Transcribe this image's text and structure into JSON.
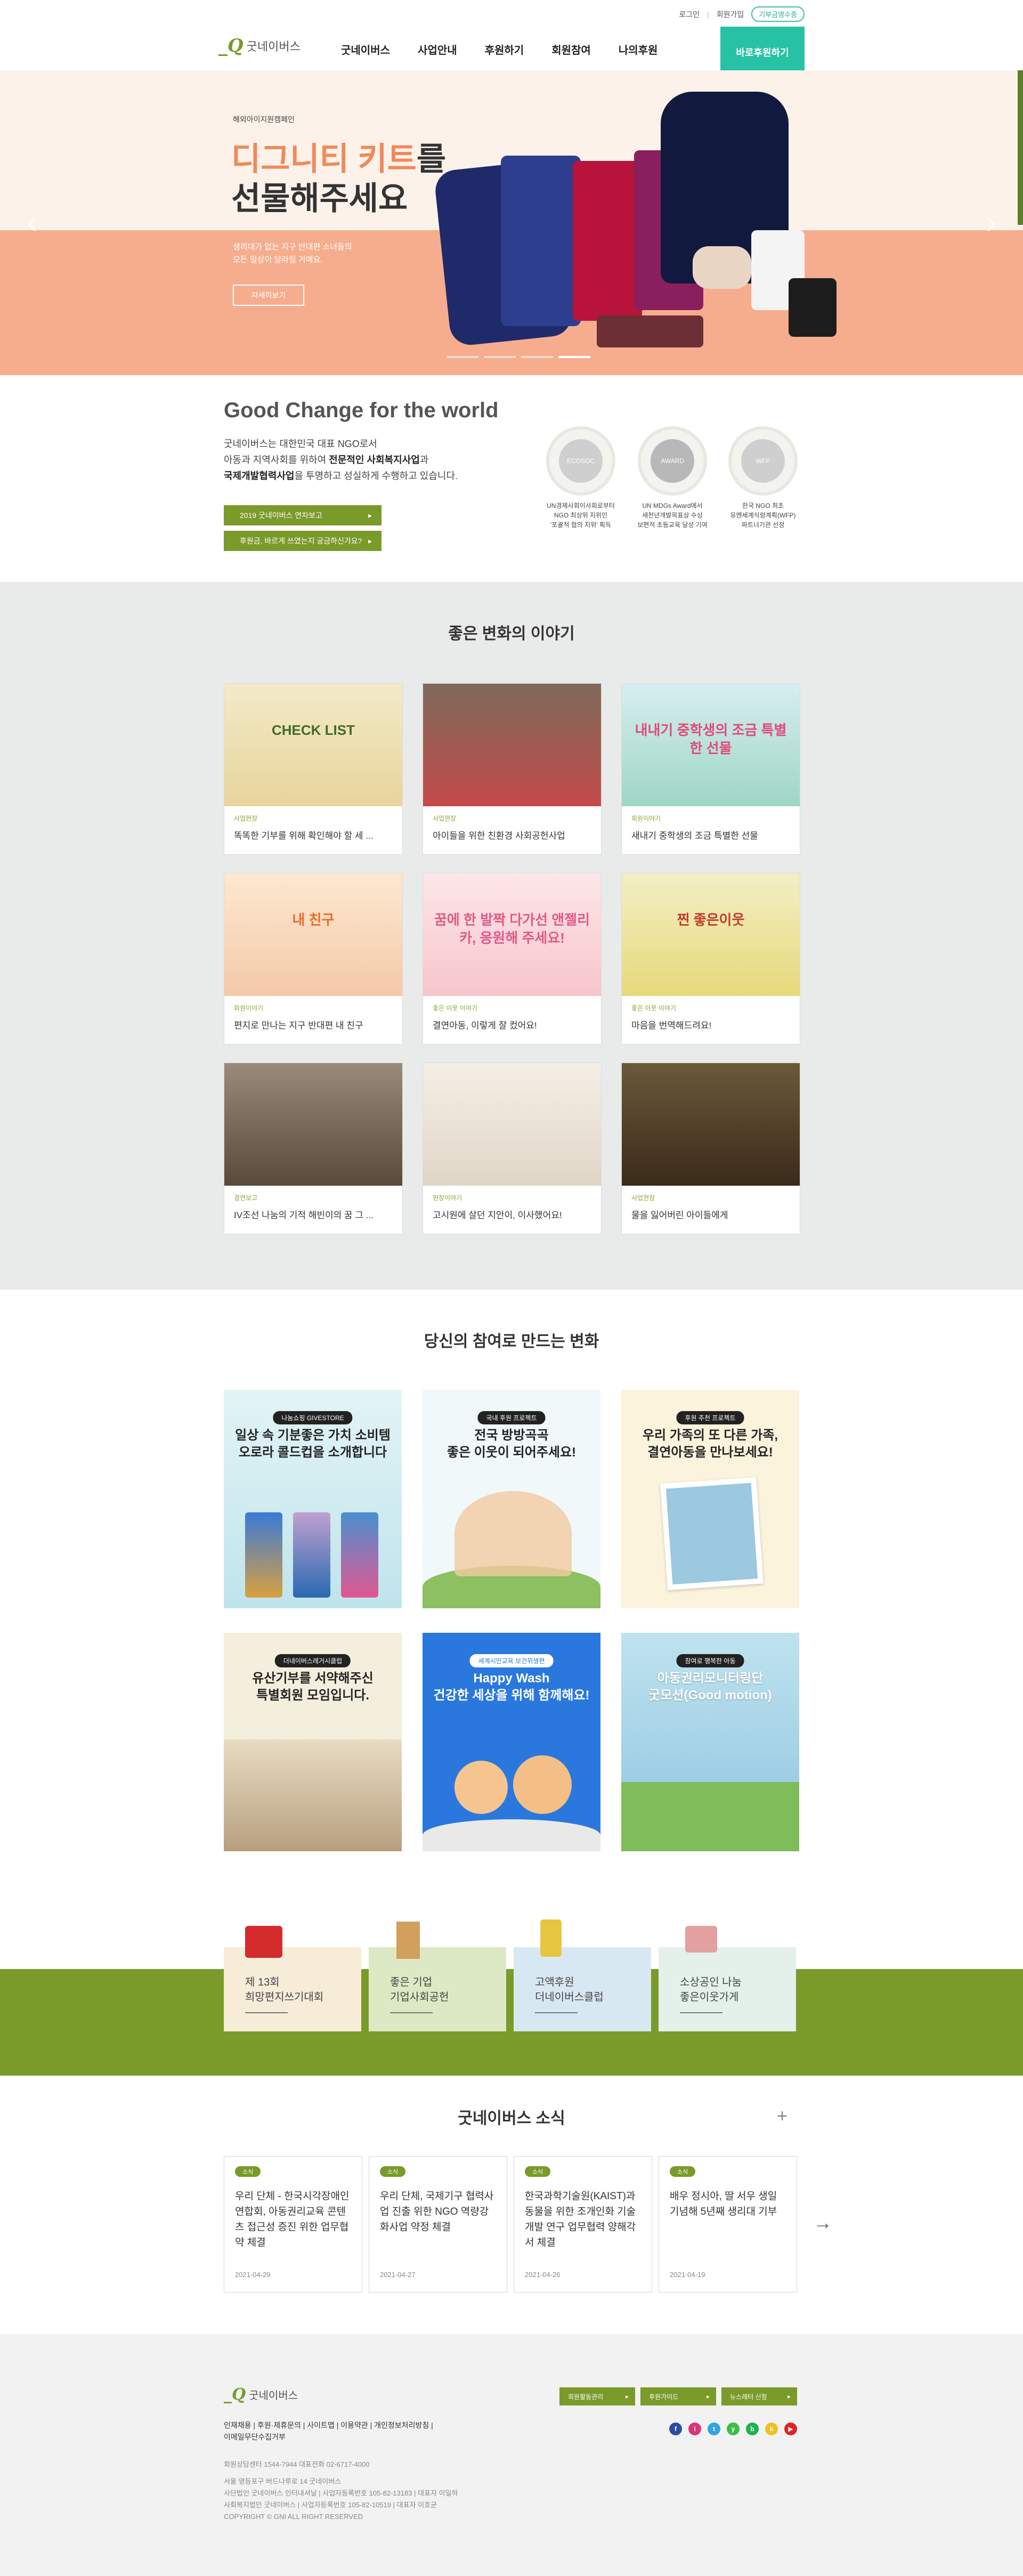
{
  "header": {
    "util": {
      "login": "로그인",
      "join": "회원가입",
      "donate_receipt": "기부금영수증"
    },
    "logo_text": "굿네이버스",
    "nav": [
      "굿네이버스",
      "사업안내",
      "후원하기",
      "회원참여",
      "나의후원"
    ],
    "donate_button": "바로후원하기"
  },
  "hero": {
    "eyebrow": "해외아이지원캠페인",
    "title_highlight": "디그니티 키트",
    "title_rest1": "를",
    "title_line2": "선물해주세요",
    "desc_line1": "생리대가 없는 지구 반대편 소녀들의",
    "desc_line2": "모든 일상이 달라질 거예요.",
    "more": "자세히보기",
    "prev": "‹",
    "next": "›"
  },
  "goodchange": {
    "title": "Good Change for the world",
    "line1": "굿네이버스는 대한민국 대표 NGO로서",
    "line2_pre": "아동과 지역사회를 위하여 ",
    "line2_b": "전문적인 사회복지사업",
    "line2_post": "과",
    "line3_b": "국제개발협력사업",
    "line3_post": "을 투명하고 성실하게 수행하고 있습니다.",
    "btn1": "2019 굿네이버스 연차보고",
    "btn2": "후원금, 바르게 쓰였는지 궁금하신가요?",
    "awards": [
      {
        "logo": "ECOSOC",
        "cap1": "UN경제사회이사회로부터",
        "cap2": "NGO 최상위 지위인",
        "cap3": "'포괄적 협의 지위' 획득"
      },
      {
        "logo": "AWARD",
        "cap1": "UN MDGs Award에서",
        "cap2": "새천년개발목표상 수상",
        "cap3": "보편적 초등교육 달성 기여"
      },
      {
        "logo": "WFP",
        "cap1": "한국 NGO 최초",
        "cap2": "유엔세계식량계획(WFP)",
        "cap3": "파트너기관 선정"
      }
    ]
  },
  "stories": {
    "title": "좋은 변화의 이야기",
    "items": [
      {
        "cat": "사업현장",
        "title": "똑똑한 기부를 위해 확인해야 할 세 ...",
        "img": "CHECK LIST"
      },
      {
        "cat": "사업현장",
        "title": "아이들을 위한 친환경 사회공헌사업",
        "img": ""
      },
      {
        "cat": "회원이야기",
        "title": "새내기 중학생의 조금 특별한 선물",
        "img": "내내기 중학생의 조금 특별한 선물"
      },
      {
        "cat": "회원이야기",
        "title": "편지로 만나는 지구 반대편 내 친구",
        "img": "내 친구"
      },
      {
        "cat": "좋은 이웃 이야기",
        "title": "결연아동, 이렇게 잘 컸어요!",
        "img": "꿈에 한 발짝 다가선 앤젤리카, 응원해 주세요!"
      },
      {
        "cat": "좋은 이웃 이야기",
        "title": "마음을 번역해드려요!",
        "img": "찐 좋은이웃"
      },
      {
        "cat": "결연보고",
        "title": "IV조선 나눔의 기적 해빈이의 꿈 그 ...",
        "img": ""
      },
      {
        "cat": "현장이야기",
        "title": "고시원에 살던 지안이, 이사했어요!",
        "img": ""
      },
      {
        "cat": "사업현장",
        "title": "물을 잃어버린 아이들에게",
        "img": ""
      }
    ]
  },
  "participation": {
    "title": "당신의 참여로 만드는 변화",
    "items": [
      {
        "badge": "나눔쇼핑 GIVESTORE",
        "line1": "일상 속 기분좋은 가치 소비템",
        "line2": "오로라 콜드컵을 소개합니다"
      },
      {
        "badge": "국내 후원 프로젝트",
        "line1": "전국 방방곡곡",
        "line2": "좋은 이웃이 되어주세요!"
      },
      {
        "badge": "후원 추천 프로젝트",
        "line1": "우리 가족의 또 다른 가족,",
        "line2": "결연아동을 만나보세요!"
      },
      {
        "badge": "더네이버스레거시클럽",
        "line1": "유산기부를 서약해주신",
        "line2": "특별회원 모임입니다."
      },
      {
        "badge": "세계시민교육 보건위생편",
        "line1": "Happy Wash",
        "line2": "건강한 세상을 위해 함께해요!"
      },
      {
        "badge": "참여로 행복한 아동",
        "line1": "아동권리모니터링단",
        "line2": "굿모션(Good motion)"
      }
    ]
  },
  "banners": [
    {
      "line1": "제 13회",
      "line2": "희망편지쓰기대회"
    },
    {
      "line1": "좋은 기업",
      "line2": "기업사회공헌"
    },
    {
      "line1": "고액후원",
      "line2": "더네이버스클럽"
    },
    {
      "line1": "소상공인 나눔",
      "line2": "좋은이웃가게"
    }
  ],
  "news": {
    "title": "굿네이버스 소식",
    "plus": "+",
    "next": "→",
    "items": [
      {
        "tag": "소식",
        "title": "우리 단체 - 한국시각장애인연합회, 아동권리교육 콘텐츠 접근성 증진 위한 업무협약 체결",
        "date": "2021-04-29"
      },
      {
        "tag": "소식",
        "title": "우리 단체, 국제기구 협력사업 진출 위한 NGO 역량강화사업 약정 체결",
        "date": "2021-04-27"
      },
      {
        "tag": "소식",
        "title": "한국과학기술원(KAIST)과 동물을 위한 조개인화 기술개발 연구 업무협력 양해각서 체결",
        "date": "2021-04-26"
      },
      {
        "tag": "소식",
        "title": "배우 정시아, 딸 서우 생일 기념해 5년째 생리대 기부",
        "date": "2021-04-19"
      }
    ]
  },
  "footer": {
    "logo_text": "굿네이버스",
    "buttons": [
      "회원활동관리",
      "후원가이드",
      "뉴스레터 신청"
    ],
    "sns": [
      "f",
      "i",
      "t",
      "y",
      "b",
      "k",
      "▶"
    ],
    "links_line1": "인재채용  |  후원·제휴문의  |  사이트맵  |  이용약관  |  개인정보처리방침  |",
    "links_line2": "이메일무단수집거부",
    "info1": "회원상담센터 1544-7944     대표전화 02-6717-4000",
    "info2": "서울 영등포구 버드나루로 14 굿네이버스",
    "info3": "사단법인 굿네이버스 인터내셔날 | 사업자등록번호 105-82-13183 | 대표자 이일하",
    "info4": "사회복지법인 굿네이버스 | 사업자등록번호 105-82-10519 | 대표자 이호균",
    "info5": "COPYRIGHT © GNI ALL RIGHT RESERVED"
  }
}
